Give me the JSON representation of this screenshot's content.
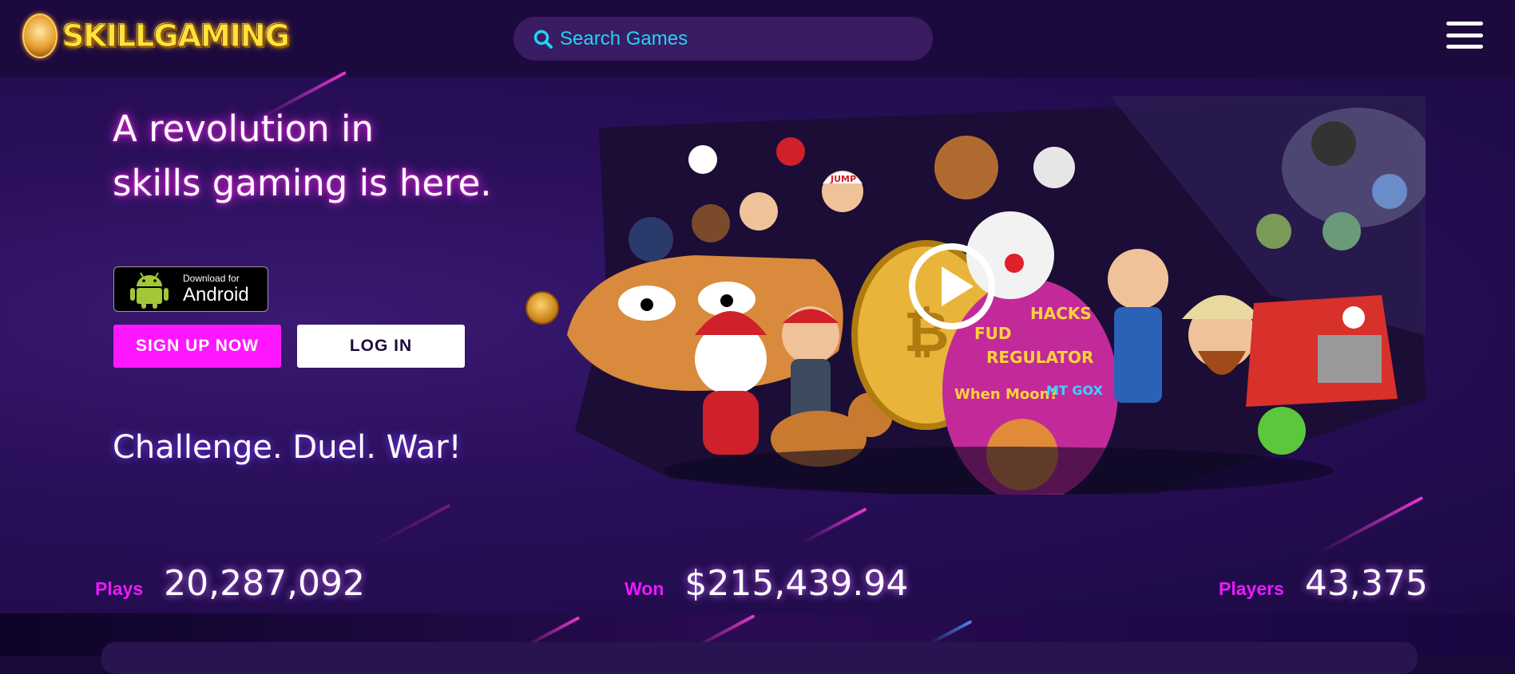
{
  "header": {
    "logo_text": "SKILLGAMING",
    "search_placeholder": "Search Games",
    "icons": {
      "search": "search-icon",
      "menu": "hamburger-menu-icon"
    }
  },
  "hero": {
    "headline_line1": "A revolution in",
    "headline_line2": "skills gaming is here.",
    "android_small": "Download for",
    "android_big": "Android",
    "signup_label": "SIGN UP NOW",
    "login_label": "LOG IN",
    "tagline": "Challenge. Duel. War!",
    "artwork_text": [
      "JUMP",
      "FUD",
      "HACKS",
      "REGULATOR",
      "When Moon?",
      "MT GOX"
    ]
  },
  "stats": [
    {
      "label": "Plays",
      "value": "20,287,092"
    },
    {
      "label": "Won",
      "value": "$215,439.94"
    },
    {
      "label": "Players",
      "value": "43,375"
    }
  ],
  "colors": {
    "background": "#1c0a3f",
    "accent_pink": "#ff17ff",
    "search_text": "#21d4f5",
    "logo_yellow": "#ffe23a"
  }
}
